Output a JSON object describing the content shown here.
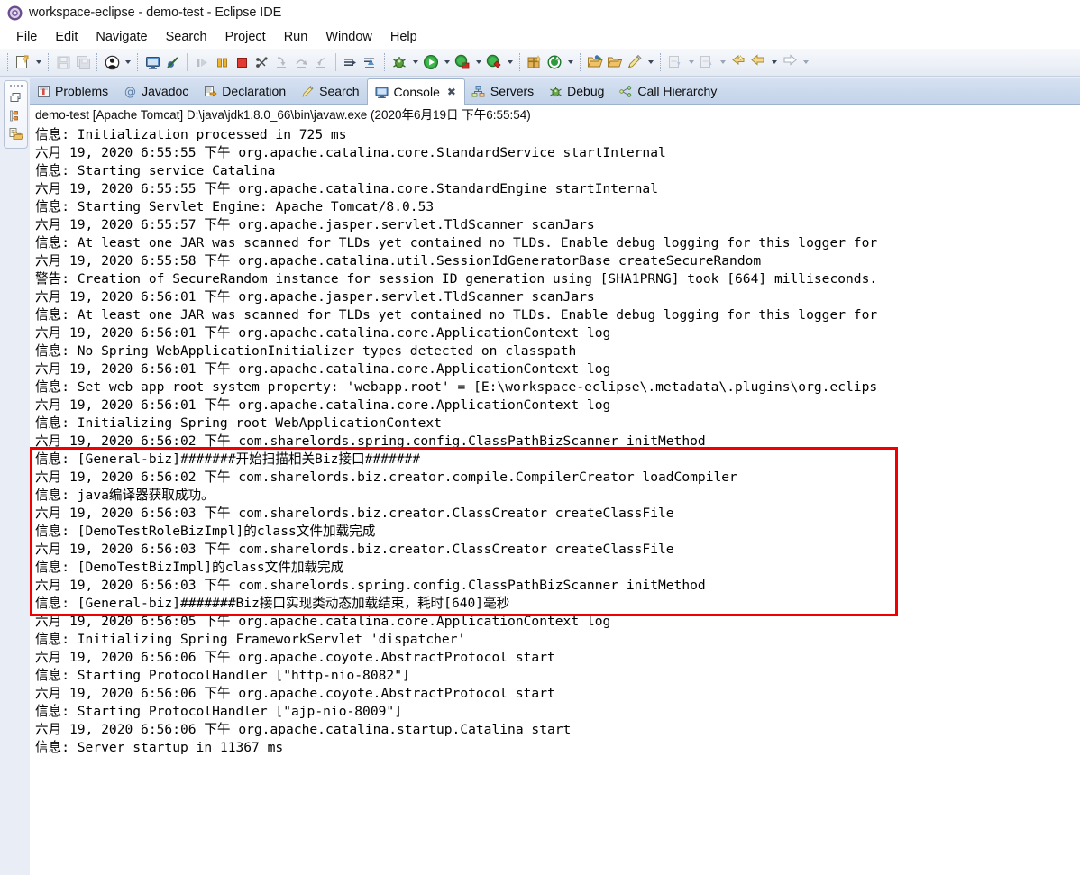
{
  "window": {
    "title": "workspace-eclipse - demo-test - Eclipse IDE",
    "app_icon": "eclipse-icon"
  },
  "menubar": {
    "items": [
      {
        "label": "File"
      },
      {
        "label": "Edit"
      },
      {
        "label": "Navigate"
      },
      {
        "label": "Search"
      },
      {
        "label": "Project"
      },
      {
        "label": "Run"
      },
      {
        "label": "Window"
      },
      {
        "label": "Help"
      }
    ]
  },
  "toolbar": {
    "groups": [
      {
        "buttons": [
          {
            "name": "new-wizard-button",
            "icon": "new-file-icon",
            "dropdown": true,
            "enabled": true
          }
        ]
      },
      {
        "buttons": [
          {
            "name": "save-button",
            "icon": "save-icon",
            "dropdown": false,
            "enabled": false
          },
          {
            "name": "save-all-button",
            "icon": "save-all-icon",
            "dropdown": false,
            "enabled": false
          }
        ]
      },
      {
        "buttons": [
          {
            "name": "toggle-user-button",
            "icon": "user-icon",
            "dropdown": true,
            "enabled": true
          }
        ]
      },
      {
        "buttons": [
          {
            "name": "open-console-button",
            "icon": "console-icon",
            "dropdown": false,
            "enabled": true
          },
          {
            "name": "skip-breakpoints-button",
            "icon": "skip-breakpoints-icon",
            "dropdown": false,
            "enabled": true
          }
        ]
      },
      {
        "buttons": [
          {
            "name": "resume-button",
            "icon": "resume-icon",
            "dropdown": false,
            "enabled": false
          },
          {
            "name": "suspend-button",
            "icon": "suspend-icon",
            "dropdown": false,
            "enabled": true
          },
          {
            "name": "terminate-button",
            "icon": "terminate-icon",
            "dropdown": false,
            "enabled": true
          },
          {
            "name": "disconnect-button",
            "icon": "disconnect-icon",
            "dropdown": false,
            "enabled": true
          },
          {
            "name": "step-into-button",
            "icon": "step-into-icon",
            "dropdown": false,
            "enabled": false
          },
          {
            "name": "step-over-button",
            "icon": "step-over-icon",
            "dropdown": false,
            "enabled": false
          },
          {
            "name": "step-return-button",
            "icon": "step-return-icon",
            "dropdown": false,
            "enabled": false
          }
        ]
      },
      {
        "buttons": [
          {
            "name": "run-last-tool-button",
            "icon": "run-to-line-icon",
            "dropdown": false,
            "enabled": true
          },
          {
            "name": "drop-to-frame-button",
            "icon": "drop-to-frame-icon",
            "dropdown": false,
            "enabled": true
          }
        ]
      },
      {
        "buttons": [
          {
            "name": "debug-button",
            "icon": "debug-bug-icon",
            "dropdown": true,
            "enabled": true
          },
          {
            "name": "run-button",
            "icon": "run-play-icon",
            "dropdown": true,
            "enabled": true
          },
          {
            "name": "coverage-button",
            "icon": "coverage-icon",
            "dropdown": true,
            "enabled": true
          },
          {
            "name": "external-tools-button",
            "icon": "external-tools-icon",
            "dropdown": true,
            "enabled": true
          }
        ]
      },
      {
        "buttons": [
          {
            "name": "new-package-button",
            "icon": "new-package-icon",
            "dropdown": false,
            "enabled": true
          },
          {
            "name": "refresh-button",
            "icon": "refresh-icon",
            "dropdown": true,
            "enabled": true
          }
        ]
      },
      {
        "buttons": [
          {
            "name": "open-type-button",
            "icon": "open-type-icon",
            "dropdown": false,
            "enabled": true
          },
          {
            "name": "open-task-button",
            "icon": "open-task-icon",
            "dropdown": false,
            "enabled": true
          },
          {
            "name": "search-button",
            "icon": "search-pencil-icon",
            "dropdown": true,
            "enabled": true
          }
        ]
      },
      {
        "buttons": [
          {
            "name": "next-annotation-button",
            "icon": "next-annotation-icon",
            "dropdown": true,
            "enabled": false
          },
          {
            "name": "previous-annotation-button",
            "icon": "previous-annotation-icon",
            "dropdown": true,
            "enabled": false
          },
          {
            "name": "last-edit-location-button",
            "icon": "last-edit-location-icon",
            "dropdown": false,
            "enabled": true
          },
          {
            "name": "back-button",
            "icon": "back-arrow-icon",
            "dropdown": true,
            "enabled": true
          },
          {
            "name": "forward-button",
            "icon": "forward-arrow-icon",
            "dropdown": true,
            "enabled": false
          }
        ]
      }
    ]
  },
  "trim_stack": {
    "items": [
      {
        "name": "restore-icon",
        "label": "restore"
      },
      {
        "name": "package-explorer-icon",
        "label": "Package Explorer"
      },
      {
        "name": "project-explorer-icon",
        "label": "Project Explorer"
      }
    ]
  },
  "view_tabs": [
    {
      "label": "Problems",
      "icon": "problems-icon",
      "active": false,
      "closable": false
    },
    {
      "label": "Javadoc",
      "icon": "javadoc-icon",
      "active": false,
      "closable": false
    },
    {
      "label": "Declaration",
      "icon": "declaration-icon",
      "active": false,
      "closable": false
    },
    {
      "label": "Search",
      "icon": "search-icon",
      "active": false,
      "closable": false
    },
    {
      "label": "Console",
      "icon": "console-icon",
      "active": true,
      "closable": true
    },
    {
      "label": "Servers",
      "icon": "servers-icon",
      "active": false,
      "closable": false
    },
    {
      "label": "Debug",
      "icon": "debug-icon",
      "active": false,
      "closable": false
    },
    {
      "label": "Call Hierarchy",
      "icon": "call-hierarchy-icon",
      "active": false,
      "closable": false
    }
  ],
  "console": {
    "process_header": "demo-test [Apache Tomcat] D:\\java\\jdk1.8.0_66\\bin\\javaw.exe (2020年6月19日 下午6:55:54)",
    "lines": [
      "信息: Initialization processed in 725 ms",
      "六月 19, 2020 6:55:55 下午 org.apache.catalina.core.StandardService startInternal",
      "信息: Starting service Catalina",
      "六月 19, 2020 6:55:55 下午 org.apache.catalina.core.StandardEngine startInternal",
      "信息: Starting Servlet Engine: Apache Tomcat/8.0.53",
      "六月 19, 2020 6:55:57 下午 org.apache.jasper.servlet.TldScanner scanJars",
      "信息: At least one JAR was scanned for TLDs yet contained no TLDs. Enable debug logging for this logger for",
      "六月 19, 2020 6:55:58 下午 org.apache.catalina.util.SessionIdGeneratorBase createSecureRandom",
      "警告: Creation of SecureRandom instance for session ID generation using [SHA1PRNG] took [664] milliseconds.",
      "六月 19, 2020 6:56:01 下午 org.apache.jasper.servlet.TldScanner scanJars",
      "信息: At least one JAR was scanned for TLDs yet contained no TLDs. Enable debug logging for this logger for",
      "六月 19, 2020 6:56:01 下午 org.apache.catalina.core.ApplicationContext log",
      "信息: No Spring WebApplicationInitializer types detected on classpath",
      "六月 19, 2020 6:56:01 下午 org.apache.catalina.core.ApplicationContext log",
      "信息: Set web app root system property: 'webapp.root' = [E:\\workspace-eclipse\\.metadata\\.plugins\\org.eclips",
      "六月 19, 2020 6:56:01 下午 org.apache.catalina.core.ApplicationContext log",
      "信息: Initializing Spring root WebApplicationContext",
      "六月 19, 2020 6:56:02 下午 com.sharelords.spring.config.ClassPathBizScanner initMethod",
      "信息: [General-biz]#######开始扫描相关Biz接口#######",
      "六月 19, 2020 6:56:02 下午 com.sharelords.biz.creator.compile.CompilerCreator loadCompiler",
      "信息: java编译器获取成功。",
      "六月 19, 2020 6:56:03 下午 com.sharelords.biz.creator.ClassCreator createClassFile",
      "信息: [DemoTestRoleBizImpl]的class文件加载完成",
      "六月 19, 2020 6:56:03 下午 com.sharelords.biz.creator.ClassCreator createClassFile",
      "信息: [DemoTestBizImpl]的class文件加载完成",
      "六月 19, 2020 6:56:03 下午 com.sharelords.spring.config.ClassPathBizScanner initMethod",
      "信息: [General-biz]#######Biz接口实现类动态加载结束，耗时[640]毫秒",
      "六月 19, 2020 6:56:05 下午 org.apache.catalina.core.ApplicationContext log",
      "信息: Initializing Spring FrameworkServlet 'dispatcher'",
      "六月 19, 2020 6:56:06 下午 org.apache.coyote.AbstractProtocol start",
      "信息: Starting ProtocolHandler [\"http-nio-8082\"]",
      "六月 19, 2020 6:56:06 下午 org.apache.coyote.AbstractProtocol start",
      "信息: Starting ProtocolHandler [\"ajp-nio-8009\"]",
      "六月 19, 2020 6:56:06 下午 org.apache.catalina.startup.Catalina start",
      "信息: Server startup in 11367 ms"
    ]
  },
  "annotation": {
    "highlight_color": "#f00000",
    "first_line_index": 18,
    "last_line_index": 26
  }
}
